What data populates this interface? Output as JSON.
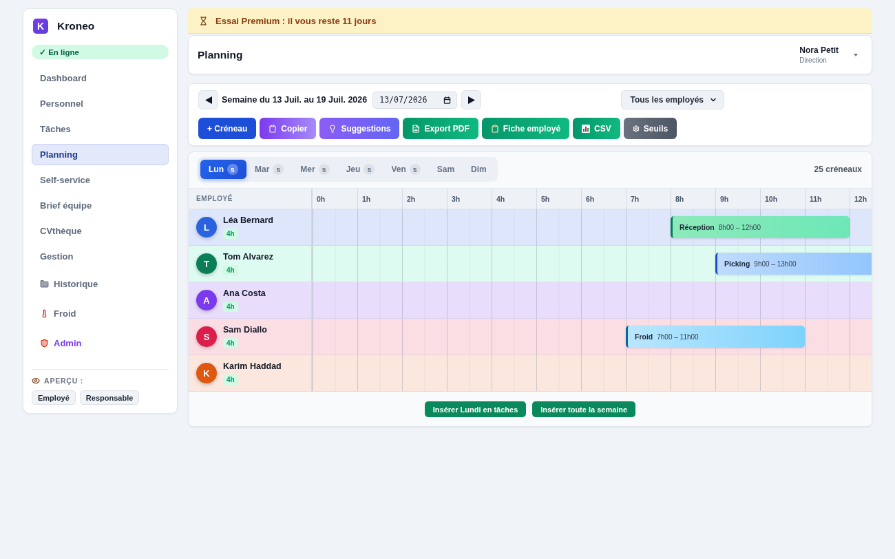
{
  "sidebar": {
    "logo_letter": "K",
    "brand": "Kroneo",
    "status": "✓ En ligne",
    "items": [
      {
        "label": "Dashboard",
        "kind": "page",
        "selected": false
      },
      {
        "label": "Personnel",
        "kind": "page",
        "selected": false
      },
      {
        "label": "Tâches",
        "kind": "page",
        "selected": false
      },
      {
        "label": "Planning",
        "kind": "page",
        "selected": true
      },
      {
        "label": "Self-service",
        "kind": "page",
        "selected": false
      },
      {
        "label": "Brief équipe",
        "kind": "page",
        "selected": false
      },
      {
        "label": "CVthèque",
        "kind": "page",
        "selected": false
      },
      {
        "label": "Gestion",
        "kind": "page",
        "selected": false
      },
      {
        "label": "Historique",
        "kind": "archive",
        "selected": false
      },
      {
        "label": "Froid",
        "kind": "cold",
        "selected": false
      },
      {
        "label": "Admin",
        "kind": "admin",
        "selected": false
      }
    ],
    "preview": {
      "label": "APERÇU :",
      "options": [
        "Employé",
        "Responsable"
      ]
    }
  },
  "banner": {
    "text": "Essai Premium : il vous reste 11 jours"
  },
  "header": {
    "title": "Planning",
    "user": {
      "name": "Nora Petit",
      "role": "Direction"
    }
  },
  "toolbar": {
    "week": "Semaine du 13 Juil. au 19 Juil. 2026",
    "date": "13/07/2026",
    "filter": "Tous les employés",
    "actions": [
      {
        "label": "+ Créneau",
        "kind": "add"
      },
      {
        "label": "Copier",
        "kind": "copy"
      },
      {
        "label": "Suggestions",
        "kind": "suggest"
      },
      {
        "label": "Export PDF",
        "kind": "pdf"
      },
      {
        "label": "Fiche employé",
        "kind": "sheet"
      },
      {
        "label": "CSV",
        "kind": "csv"
      },
      {
        "label": "Seuils",
        "kind": "thresholds"
      }
    ]
  },
  "planning": {
    "days": [
      {
        "label": "Lun",
        "count": "5",
        "selected": true
      },
      {
        "label": "Mar",
        "count": "5",
        "selected": false
      },
      {
        "label": "Mer",
        "count": "5",
        "selected": false
      },
      {
        "label": "Jeu",
        "count": "5",
        "selected": false
      },
      {
        "label": "Ven",
        "count": "5",
        "selected": false
      },
      {
        "label": "Sam",
        "selected": false
      },
      {
        "label": "Dim",
        "selected": false
      }
    ],
    "total": "25 créneaux",
    "employee_heading": "EMPLOYÉ",
    "hours": [
      "0h",
      "1h",
      "2h",
      "3h",
      "4h",
      "5h",
      "6h",
      "7h",
      "8h",
      "9h",
      "10h",
      "11h",
      "12h"
    ],
    "rows": [
      {
        "initial": "L",
        "name": "Léa Bernard",
        "hours": "4h",
        "color": "#2b62e0",
        "shifts": [
          {
            "label": "Réception",
            "time": "8h00 – 12h00",
            "kind": "reception"
          }
        ]
      },
      {
        "initial": "T",
        "name": "Tom Alvarez",
        "hours": "4h",
        "color": "#0a7f56",
        "shifts": [
          {
            "label": "Picking",
            "time": "9h00 – 13h00",
            "kind": "picking"
          }
        ]
      },
      {
        "initial": "A",
        "name": "Ana Costa",
        "hours": "4h",
        "color": "#7c3aed",
        "shifts": []
      },
      {
        "initial": "S",
        "name": "Sam Diallo",
        "hours": "4h",
        "color": "#dc1f4a",
        "shifts": [
          {
            "label": "Froid",
            "time": "7h00 – 11h00",
            "kind": "cold"
          }
        ]
      },
      {
        "initial": "K",
        "name": "Karim Haddad",
        "hours": "4h",
        "color": "#e0580f",
        "shifts": []
      }
    ],
    "footer_buttons": [
      "Insérer Lundi en tâches",
      "Insérer toute la semaine"
    ]
  }
}
